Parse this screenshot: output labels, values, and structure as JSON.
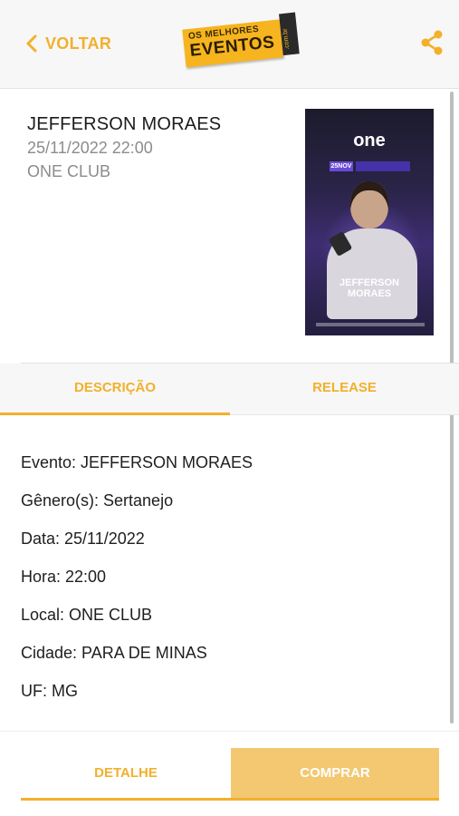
{
  "header": {
    "back_label": "VOLTAR",
    "logo": {
      "line1": "OS MELHORES",
      "line2": "EVENTOS",
      "line3": ".com.br"
    }
  },
  "event": {
    "title": "JEFFERSON MORAES",
    "datetime": "25/11/2022 22:00",
    "venue": "ONE CLUB"
  },
  "poster": {
    "brand": "one",
    "date_badge": "25NOV",
    "artist_line1": "JEFFERSON",
    "artist_line2": "MORAES"
  },
  "tabs": [
    {
      "label": "DESCRIÇÃO",
      "active": true
    },
    {
      "label": "RELEASE",
      "active": false
    }
  ],
  "details": [
    "Evento: JEFFERSON MORAES",
    "Gênero(s): Sertanejo",
    "Data: 25/11/2022",
    "Hora: 22:00",
    "Local: ONE CLUB",
    "Cidade: PARA DE MINAS",
    "UF: MG"
  ],
  "actions": {
    "detalhe_label": "DETALHE",
    "comprar_label": "COMPRAR"
  },
  "colors": {
    "accent": "#f2b02c",
    "buy_button_bg": "#f3c871",
    "header_bg": "#f7f7f7"
  },
  "icons": {
    "back": "chevron-left-icon",
    "share": "share-icon"
  }
}
